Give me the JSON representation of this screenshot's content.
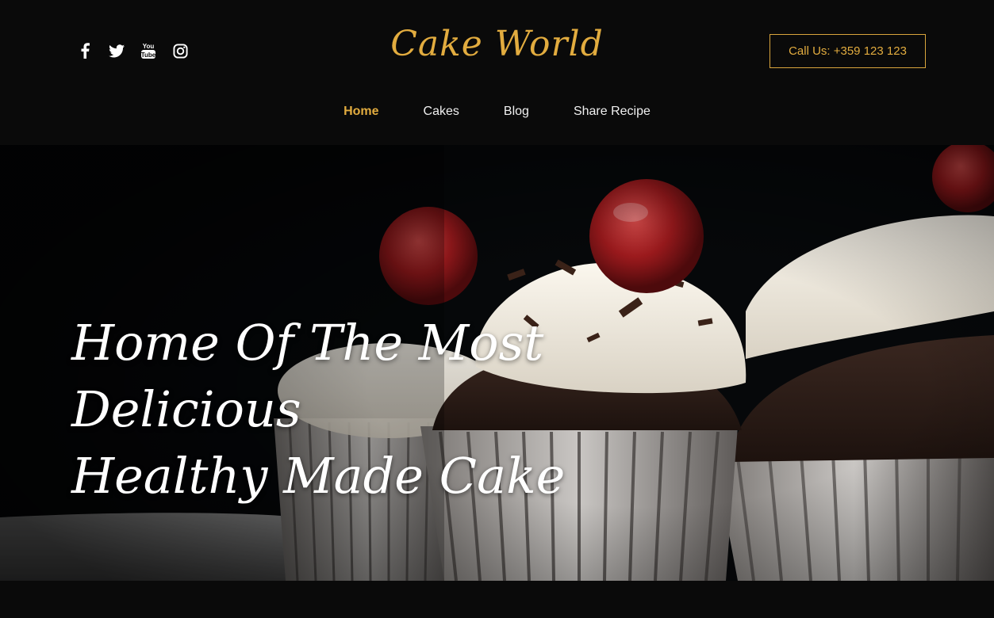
{
  "header": {
    "brand": "Cake World",
    "call_label": "Call Us: +359 123 123",
    "social": [
      {
        "icon": "facebook-icon"
      },
      {
        "icon": "twitter-icon"
      },
      {
        "icon": "youtube-icon"
      },
      {
        "icon": "instagram-icon"
      }
    ]
  },
  "nav": {
    "items": [
      {
        "label": "Home",
        "active": true
      },
      {
        "label": "Cakes",
        "active": false
      },
      {
        "label": "Blog",
        "active": false
      },
      {
        "label": "Share Recipe",
        "active": false
      }
    ]
  },
  "hero": {
    "title_line1": "Home Of The Most Delicious",
    "title_line2": "Healthy Made Cake",
    "image": "cupcakes-photo"
  },
  "colors": {
    "accent": "#e2ac3f",
    "background": "#0a0a0a",
    "text": "#ffffff"
  }
}
